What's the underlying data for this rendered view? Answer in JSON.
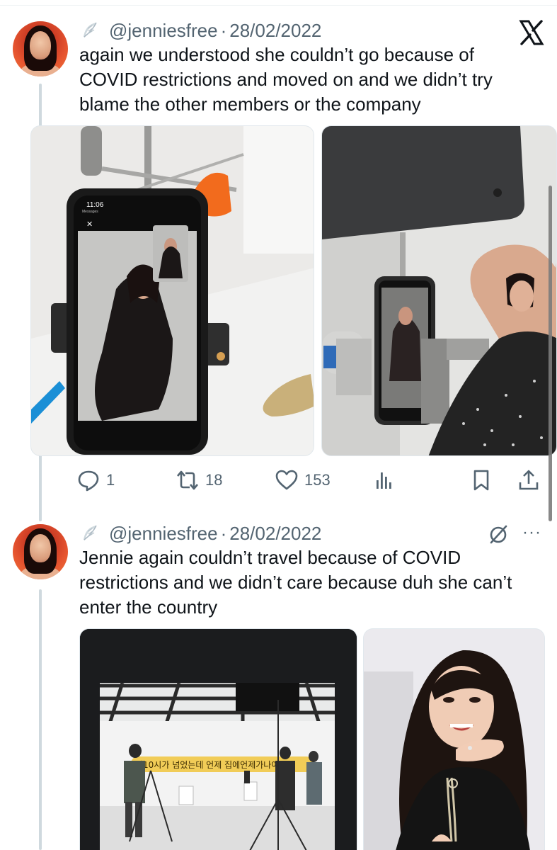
{
  "tweets": [
    {
      "handle": "@jenniesfree",
      "separator": "·",
      "date": "28/02/2022",
      "text": "again we understood she couldn’t go because of COVID restrictions and moved on and we didn’t try blame the other members or the company",
      "corner_icon": "x-logo-icon",
      "media": [
        {
          "description_icon": "phone-on-tripod-photo",
          "phone_time": "11:06",
          "phone_label": "Messages"
        },
        {
          "description_icon": "photo-shoot-photo"
        }
      ],
      "stats": {
        "replies": "1",
        "retweets": "18",
        "likes": "153"
      }
    },
    {
      "handle": "@jenniesfree",
      "separator": "·",
      "date": "28/02/2022",
      "text": "Jennie again couldn’t travel because of COVID restrictions and we didn’t care because duh she can’t enter the country",
      "corner_icon": "grok-icon",
      "more": "···",
      "media": [
        {
          "description_icon": "studio-video-screenshot",
          "caption_overlay": "밤10시가 넘었는데 언제 집에언제가나여"
        },
        {
          "description_icon": "portrait-photo"
        }
      ]
    }
  ],
  "colors": {
    "text": "#0f1419",
    "muted": "#536471",
    "thread_line": "#cfd9de",
    "orange_accent": "#e6542f"
  }
}
